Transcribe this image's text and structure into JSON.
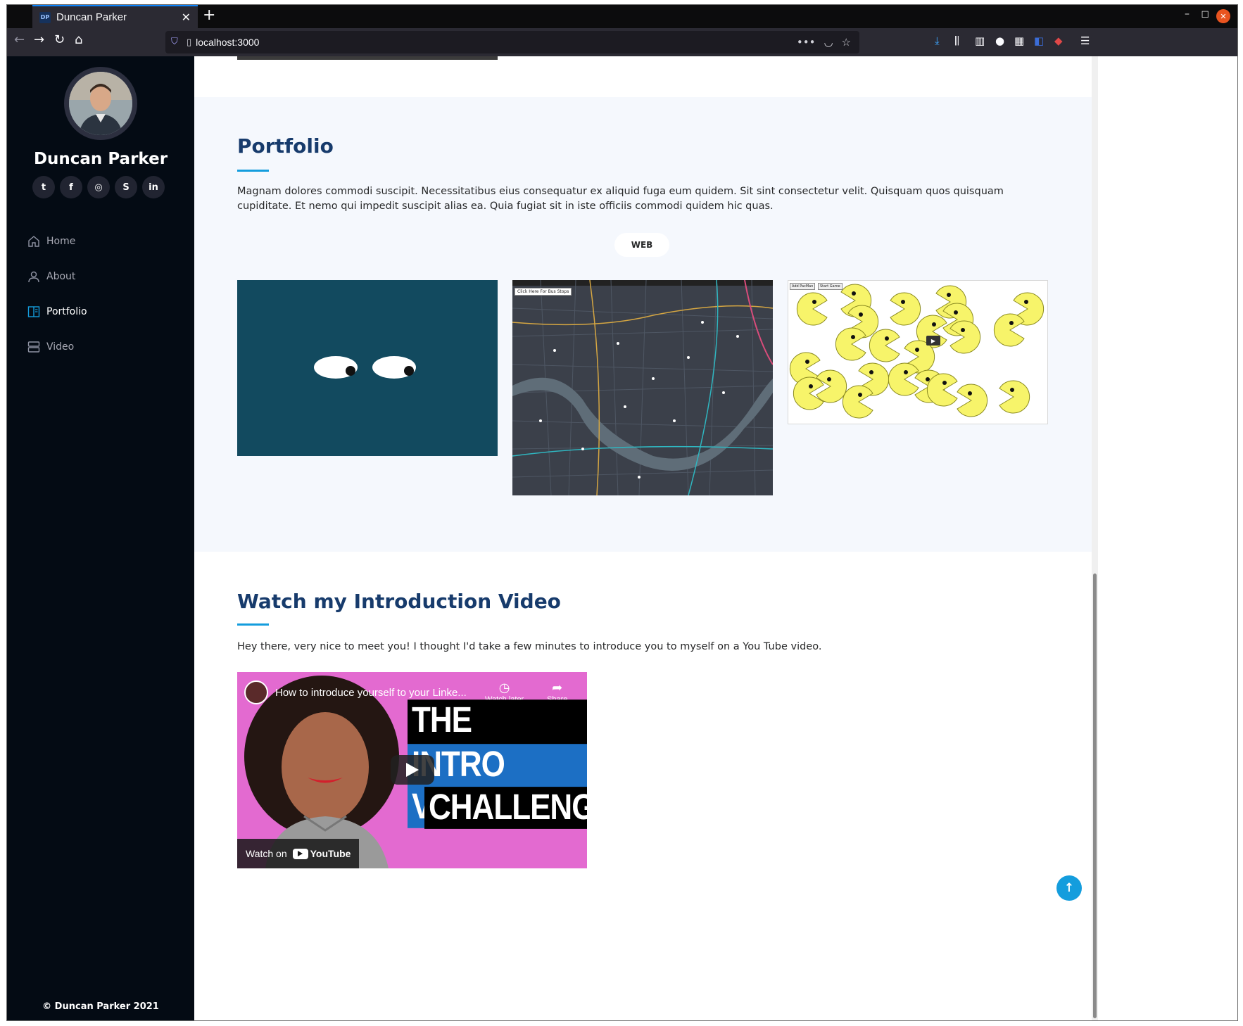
{
  "browser": {
    "tab_title": "Duncan Parker",
    "tab_favicon": "DP",
    "new_tab_label": "+",
    "url": "localhost:3000"
  },
  "sidebar": {
    "name": "Duncan Parker",
    "social": [
      {
        "icon": "twitter-icon",
        "glyph": "t"
      },
      {
        "icon": "facebook-icon",
        "glyph": "f"
      },
      {
        "icon": "instagram-icon",
        "glyph": "◎"
      },
      {
        "icon": "skype-icon",
        "glyph": "S"
      },
      {
        "icon": "linkedin-icon",
        "glyph": "in"
      }
    ],
    "nav": [
      {
        "label": "Home",
        "icon": "house-icon",
        "active": false
      },
      {
        "label": "About",
        "icon": "person-icon",
        "active": false
      },
      {
        "label": "Portfolio",
        "icon": "book-icon",
        "active": true
      },
      {
        "label": "Video",
        "icon": "server-icon",
        "active": false
      }
    ],
    "footer": "© Duncan Parker 2021"
  },
  "portfolio": {
    "title": "Portfolio",
    "description": "Magnam dolores commodi suscipit. Necessitatibus eius consequatur ex aliquid fuga eum quidem. Sit sint consectetur velit. Quisquam quos quisquam cupiditate. Et nemo qui impedit suscipit alias ea. Quia fugiat sit in iste officiis commodi quidem hic quas.",
    "filter": "WEB",
    "map_button": "Click Here For Bus Stops",
    "pacman_buttons": [
      "Add PacMan",
      "Start Game"
    ]
  },
  "video_section": {
    "title": "Watch my Introduction Video",
    "description": "Hey there, very nice to meet you! I thought I'd take a few minutes to introduce you to myself on a You Tube video.",
    "video_title": "How to introduce yourself to your Linke...",
    "watch_later": "Watch later",
    "share": "Share",
    "headline": [
      "THE LINKEDIN",
      "INTRO VIDEO",
      "CHALLENGE"
    ],
    "watch_on": "Watch on",
    "youtube": "YouTube"
  },
  "colors": {
    "accent": "#149ddd",
    "heading": "#173b6c",
    "sidebar_bg": "#040b14"
  }
}
